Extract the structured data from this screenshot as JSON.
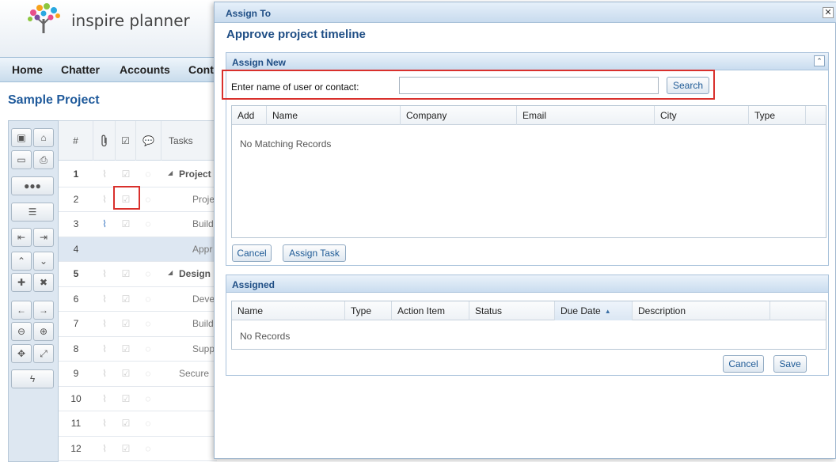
{
  "app": {
    "brand": "inspire planner",
    "nav": [
      "Home",
      "Chatter",
      "Accounts",
      "Cont"
    ],
    "project_title": "Sample Project"
  },
  "grid": {
    "headers": {
      "num": "#",
      "tasks": "Tasks"
    },
    "rows": [
      {
        "num": "1",
        "task": "Project",
        "bold": true,
        "clip": false
      },
      {
        "num": "2",
        "task": "Proje",
        "bold": false,
        "clip": false
      },
      {
        "num": "3",
        "task": "Build",
        "bold": false,
        "clip": true
      },
      {
        "num": "4",
        "task": "Appr",
        "bold": false,
        "clip": false,
        "selected": true
      },
      {
        "num": "5",
        "task": "Design",
        "bold": true,
        "clip": false
      },
      {
        "num": "6",
        "task": "Deve",
        "bold": false,
        "clip": false
      },
      {
        "num": "7",
        "task": "Build",
        "bold": false,
        "clip": false
      },
      {
        "num": "8",
        "task": "Supp",
        "bold": false,
        "clip": false
      },
      {
        "num": "9",
        "task": "Secure",
        "bold": false,
        "clip": false
      },
      {
        "num": "10",
        "task": "",
        "bold": false,
        "clip": false
      },
      {
        "num": "11",
        "task": "",
        "bold": false,
        "clip": false
      },
      {
        "num": "12",
        "task": "",
        "bold": false,
        "clip": false
      }
    ]
  },
  "modal": {
    "title": "Assign To",
    "heading": "Approve project timeline",
    "assign_new": {
      "title": "Assign New",
      "search_label": "Enter name of user or contact:",
      "search_value": "",
      "search_button": "Search",
      "columns": [
        "Add",
        "Name",
        "Company",
        "Email",
        "City",
        "Type"
      ],
      "empty": "No Matching Records",
      "cancel": "Cancel",
      "assign_task": "Assign Task"
    },
    "assigned": {
      "title": "Assigned",
      "columns": [
        "Name",
        "Type",
        "Action Item",
        "Status",
        "Due Date",
        "Description"
      ],
      "sorted_column": "Due Date",
      "empty": "No Records",
      "cancel": "Cancel",
      "save": "Save"
    }
  },
  "colors": {
    "accent": "#1f4e85",
    "highlight": "#d9302c"
  }
}
